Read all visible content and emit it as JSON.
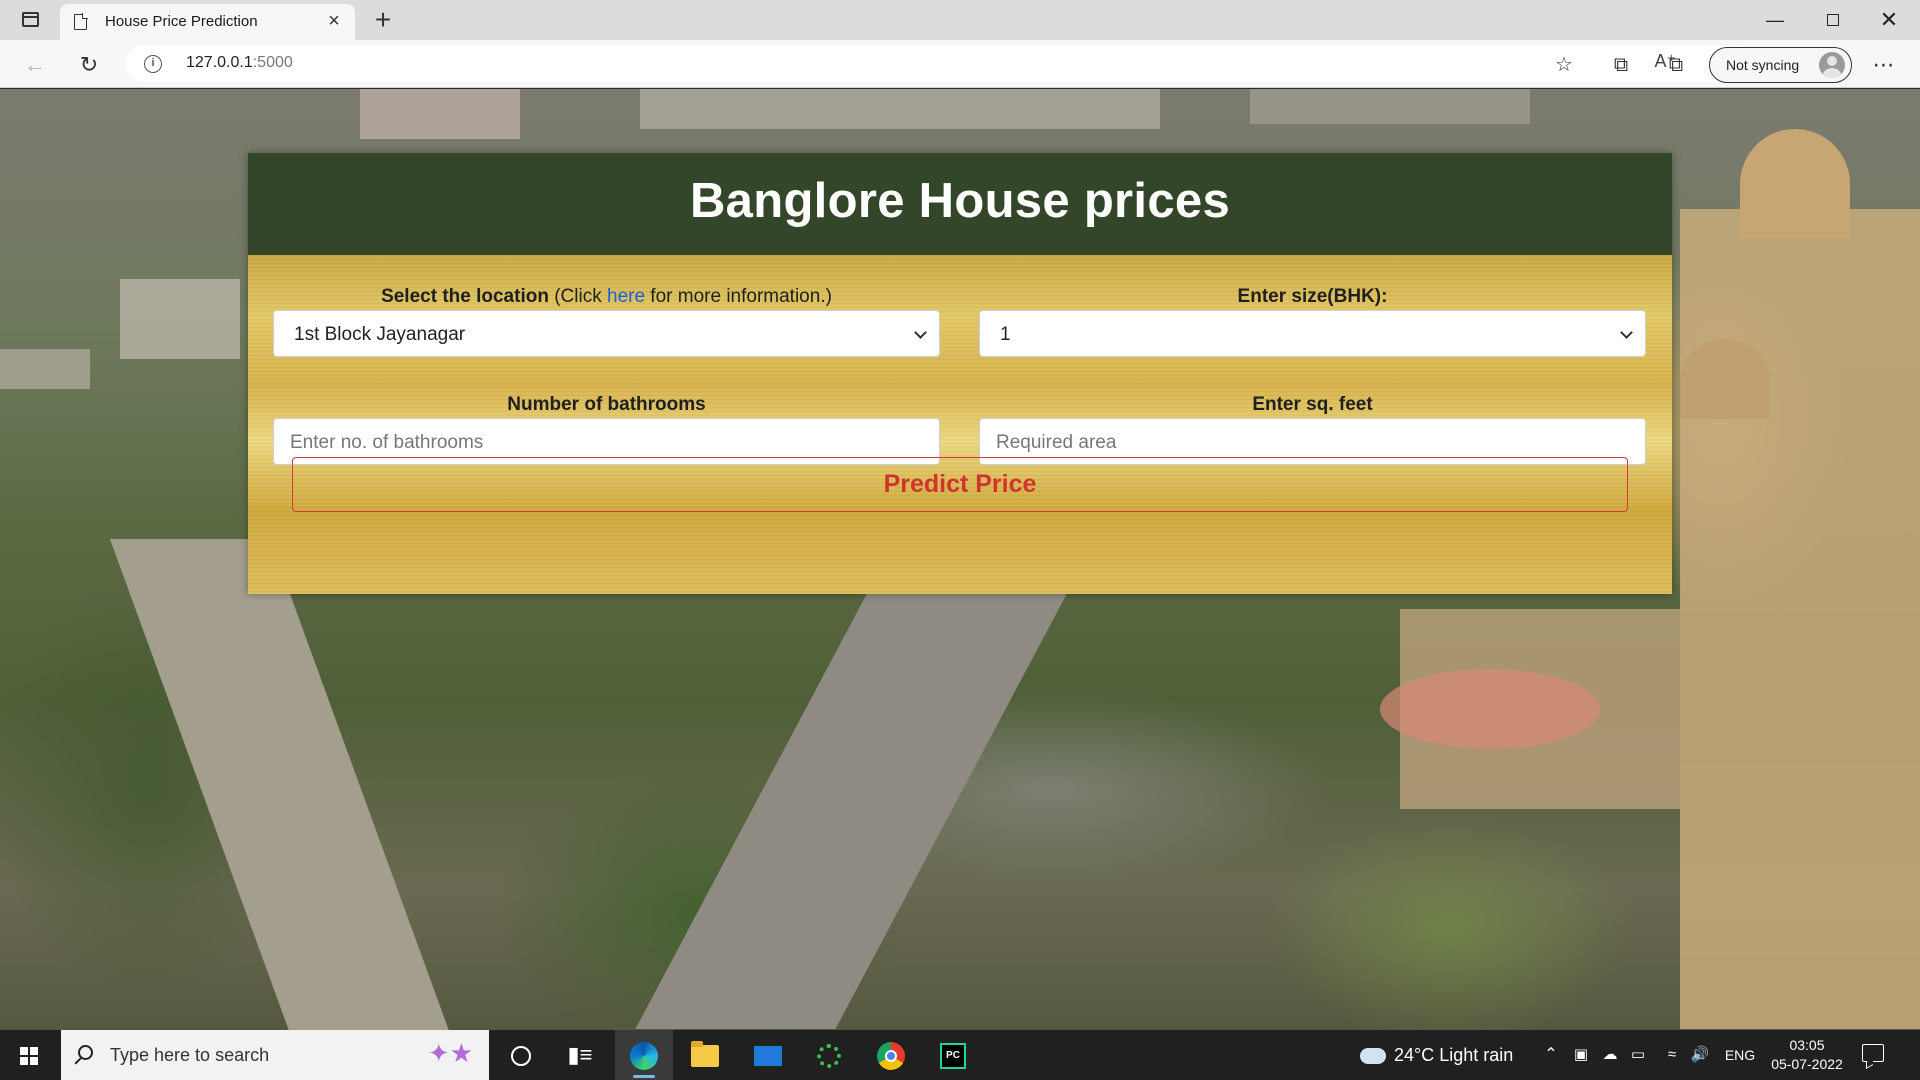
{
  "browser": {
    "tab_title": "House Price Prediction",
    "tab_close": "×",
    "new_tab": "+",
    "url_host": "127.0.0.1",
    "url_port": ":5000",
    "sync_label": "Not syncing",
    "icons": [
      "sidebar-icon",
      "page-icon",
      "back-icon",
      "reload-icon",
      "info-icon",
      "read-aloud-icon",
      "add-favorite-icon",
      "favorites-icon",
      "collections-icon",
      "share-icon",
      "profile-icon",
      "more-icon"
    ]
  },
  "page": {
    "title": "Banglore House prices",
    "location_label": "Select the location",
    "location_hint_prefix": " (Click ",
    "location_hint_link": "here",
    "location_hint_suffix": " for more information.)",
    "location_value": "1st Block Jayanagar",
    "bhk_label": "Enter size(BHK):",
    "bhk_value": "1",
    "bath_label": "Number of bathrooms",
    "bath_placeholder": "Enter no. of bathrooms",
    "sqft_label": "Enter sq. feet",
    "sqft_placeholder": "Required area",
    "predict_label": "Predict Price"
  },
  "taskbar": {
    "search_text": "Type here to search",
    "weather": "24°C  Light rain",
    "lang": "ENG",
    "time": "03:05",
    "date": "05-07-2022",
    "apps": [
      "cortana-icon",
      "task-view-icon",
      "edge-icon",
      "file-explorer-icon",
      "mail-icon",
      "app-green-icon",
      "chrome-icon",
      "pycharm-icon"
    ]
  },
  "colors": {
    "header_bg": "#2f4225",
    "button_text": "#d0342c",
    "link": "#1a5fd6",
    "gold": "#d6b24a"
  }
}
